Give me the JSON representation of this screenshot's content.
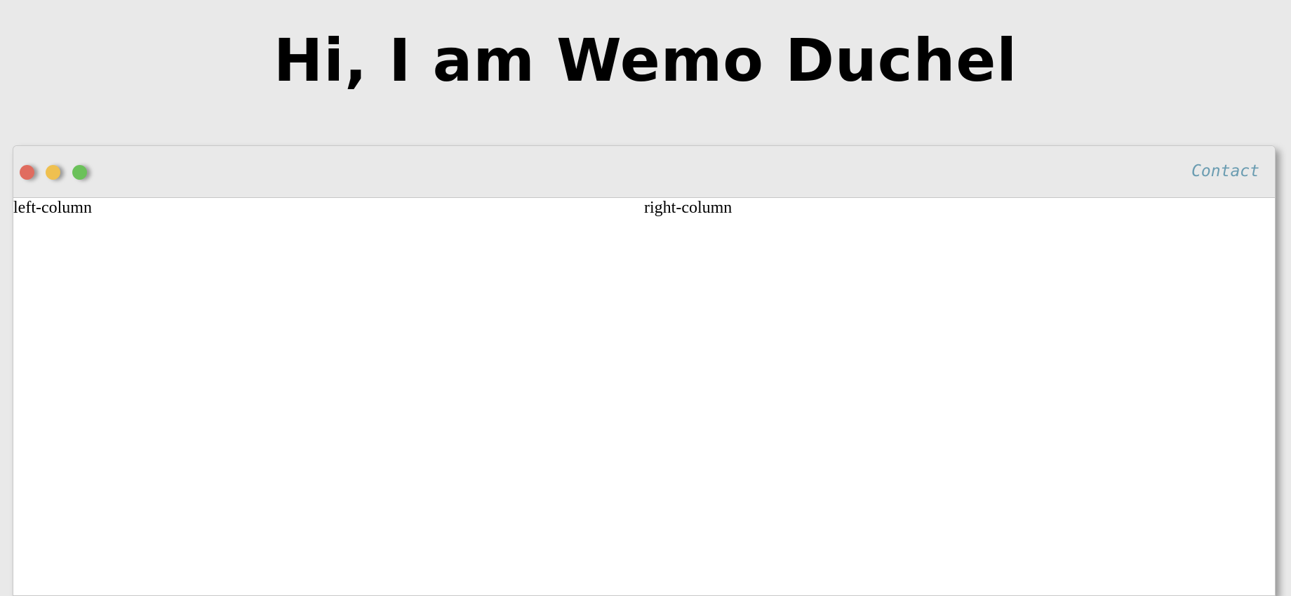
{
  "header": {
    "title": "Hi, I am Wemo Duchel"
  },
  "window": {
    "controls": [
      {
        "name": "close-dot",
        "color": "#e06c5f"
      },
      {
        "name": "minimize-dot",
        "color": "#efc050"
      },
      {
        "name": "maximize-dot",
        "color": "#6bc15a"
      }
    ],
    "contact_label": "Contact",
    "contact_color": "#6a9cb1"
  },
  "columns": {
    "left": "left-column",
    "right": "right-column"
  }
}
